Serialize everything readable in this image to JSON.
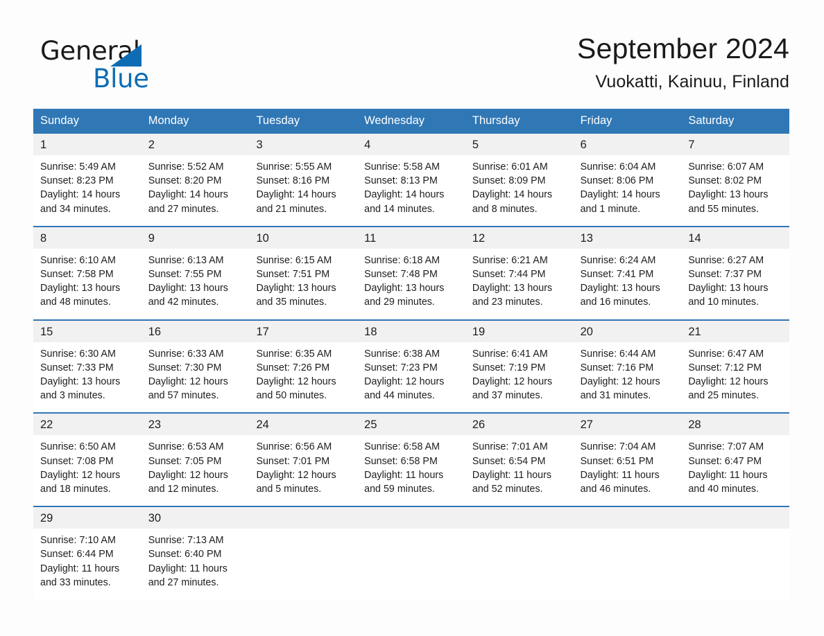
{
  "brand": {
    "name_part1": "General",
    "name_part2": "Blue",
    "triangle_color": "#0d6cb4",
    "text_color": "#1a1a1a"
  },
  "header": {
    "title": "September 2024",
    "subtitle": "Vuokatti, Kainuu, Finland",
    "accent_color": "#3077b5",
    "daynum_band_color": "#f1f1f1"
  },
  "calendar": {
    "weekdays": [
      "Sunday",
      "Monday",
      "Tuesday",
      "Wednesday",
      "Thursday",
      "Friday",
      "Saturday"
    ],
    "weeks": [
      [
        {
          "day": "1",
          "sunrise": "Sunrise: 5:49 AM",
          "sunset": "Sunset: 8:23 PM",
          "daylight_1": "Daylight: 14 hours",
          "daylight_2": "and 34 minutes."
        },
        {
          "day": "2",
          "sunrise": "Sunrise: 5:52 AM",
          "sunset": "Sunset: 8:20 PM",
          "daylight_1": "Daylight: 14 hours",
          "daylight_2": "and 27 minutes."
        },
        {
          "day": "3",
          "sunrise": "Sunrise: 5:55 AM",
          "sunset": "Sunset: 8:16 PM",
          "daylight_1": "Daylight: 14 hours",
          "daylight_2": "and 21 minutes."
        },
        {
          "day": "4",
          "sunrise": "Sunrise: 5:58 AM",
          "sunset": "Sunset: 8:13 PM",
          "daylight_1": "Daylight: 14 hours",
          "daylight_2": "and 14 minutes."
        },
        {
          "day": "5",
          "sunrise": "Sunrise: 6:01 AM",
          "sunset": "Sunset: 8:09 PM",
          "daylight_1": "Daylight: 14 hours",
          "daylight_2": "and 8 minutes."
        },
        {
          "day": "6",
          "sunrise": "Sunrise: 6:04 AM",
          "sunset": "Sunset: 8:06 PM",
          "daylight_1": "Daylight: 14 hours",
          "daylight_2": "and 1 minute."
        },
        {
          "day": "7",
          "sunrise": "Sunrise: 6:07 AM",
          "sunset": "Sunset: 8:02 PM",
          "daylight_1": "Daylight: 13 hours",
          "daylight_2": "and 55 minutes."
        }
      ],
      [
        {
          "day": "8",
          "sunrise": "Sunrise: 6:10 AM",
          "sunset": "Sunset: 7:58 PM",
          "daylight_1": "Daylight: 13 hours",
          "daylight_2": "and 48 minutes."
        },
        {
          "day": "9",
          "sunrise": "Sunrise: 6:13 AM",
          "sunset": "Sunset: 7:55 PM",
          "daylight_1": "Daylight: 13 hours",
          "daylight_2": "and 42 minutes."
        },
        {
          "day": "10",
          "sunrise": "Sunrise: 6:15 AM",
          "sunset": "Sunset: 7:51 PM",
          "daylight_1": "Daylight: 13 hours",
          "daylight_2": "and 35 minutes."
        },
        {
          "day": "11",
          "sunrise": "Sunrise: 6:18 AM",
          "sunset": "Sunset: 7:48 PM",
          "daylight_1": "Daylight: 13 hours",
          "daylight_2": "and 29 minutes."
        },
        {
          "day": "12",
          "sunrise": "Sunrise: 6:21 AM",
          "sunset": "Sunset: 7:44 PM",
          "daylight_1": "Daylight: 13 hours",
          "daylight_2": "and 23 minutes."
        },
        {
          "day": "13",
          "sunrise": "Sunrise: 6:24 AM",
          "sunset": "Sunset: 7:41 PM",
          "daylight_1": "Daylight: 13 hours",
          "daylight_2": "and 16 minutes."
        },
        {
          "day": "14",
          "sunrise": "Sunrise: 6:27 AM",
          "sunset": "Sunset: 7:37 PM",
          "daylight_1": "Daylight: 13 hours",
          "daylight_2": "and 10 minutes."
        }
      ],
      [
        {
          "day": "15",
          "sunrise": "Sunrise: 6:30 AM",
          "sunset": "Sunset: 7:33 PM",
          "daylight_1": "Daylight: 13 hours",
          "daylight_2": "and 3 minutes."
        },
        {
          "day": "16",
          "sunrise": "Sunrise: 6:33 AM",
          "sunset": "Sunset: 7:30 PM",
          "daylight_1": "Daylight: 12 hours",
          "daylight_2": "and 57 minutes."
        },
        {
          "day": "17",
          "sunrise": "Sunrise: 6:35 AM",
          "sunset": "Sunset: 7:26 PM",
          "daylight_1": "Daylight: 12 hours",
          "daylight_2": "and 50 minutes."
        },
        {
          "day": "18",
          "sunrise": "Sunrise: 6:38 AM",
          "sunset": "Sunset: 7:23 PM",
          "daylight_1": "Daylight: 12 hours",
          "daylight_2": "and 44 minutes."
        },
        {
          "day": "19",
          "sunrise": "Sunrise: 6:41 AM",
          "sunset": "Sunset: 7:19 PM",
          "daylight_1": "Daylight: 12 hours",
          "daylight_2": "and 37 minutes."
        },
        {
          "day": "20",
          "sunrise": "Sunrise: 6:44 AM",
          "sunset": "Sunset: 7:16 PM",
          "daylight_1": "Daylight: 12 hours",
          "daylight_2": "and 31 minutes."
        },
        {
          "day": "21",
          "sunrise": "Sunrise: 6:47 AM",
          "sunset": "Sunset: 7:12 PM",
          "daylight_1": "Daylight: 12 hours",
          "daylight_2": "and 25 minutes."
        }
      ],
      [
        {
          "day": "22",
          "sunrise": "Sunrise: 6:50 AM",
          "sunset": "Sunset: 7:08 PM",
          "daylight_1": "Daylight: 12 hours",
          "daylight_2": "and 18 minutes."
        },
        {
          "day": "23",
          "sunrise": "Sunrise: 6:53 AM",
          "sunset": "Sunset: 7:05 PM",
          "daylight_1": "Daylight: 12 hours",
          "daylight_2": "and 12 minutes."
        },
        {
          "day": "24",
          "sunrise": "Sunrise: 6:56 AM",
          "sunset": "Sunset: 7:01 PM",
          "daylight_1": "Daylight: 12 hours",
          "daylight_2": "and 5 minutes."
        },
        {
          "day": "25",
          "sunrise": "Sunrise: 6:58 AM",
          "sunset": "Sunset: 6:58 PM",
          "daylight_1": "Daylight: 11 hours",
          "daylight_2": "and 59 minutes."
        },
        {
          "day": "26",
          "sunrise": "Sunrise: 7:01 AM",
          "sunset": "Sunset: 6:54 PM",
          "daylight_1": "Daylight: 11 hours",
          "daylight_2": "and 52 minutes."
        },
        {
          "day": "27",
          "sunrise": "Sunrise: 7:04 AM",
          "sunset": "Sunset: 6:51 PM",
          "daylight_1": "Daylight: 11 hours",
          "daylight_2": "and 46 minutes."
        },
        {
          "day": "28",
          "sunrise": "Sunrise: 7:07 AM",
          "sunset": "Sunset: 6:47 PM",
          "daylight_1": "Daylight: 11 hours",
          "daylight_2": "and 40 minutes."
        }
      ],
      [
        {
          "day": "29",
          "sunrise": "Sunrise: 7:10 AM",
          "sunset": "Sunset: 6:44 PM",
          "daylight_1": "Daylight: 11 hours",
          "daylight_2": "and 33 minutes."
        },
        {
          "day": "30",
          "sunrise": "Sunrise: 7:13 AM",
          "sunset": "Sunset: 6:40 PM",
          "daylight_1": "Daylight: 11 hours",
          "daylight_2": "and 27 minutes."
        },
        {
          "day": "",
          "sunrise": "",
          "sunset": "",
          "daylight_1": "",
          "daylight_2": ""
        },
        {
          "day": "",
          "sunrise": "",
          "sunset": "",
          "daylight_1": "",
          "daylight_2": ""
        },
        {
          "day": "",
          "sunrise": "",
          "sunset": "",
          "daylight_1": "",
          "daylight_2": ""
        },
        {
          "day": "",
          "sunrise": "",
          "sunset": "",
          "daylight_1": "",
          "daylight_2": ""
        },
        {
          "day": "",
          "sunrise": "",
          "sunset": "",
          "daylight_1": "",
          "daylight_2": ""
        }
      ]
    ]
  }
}
